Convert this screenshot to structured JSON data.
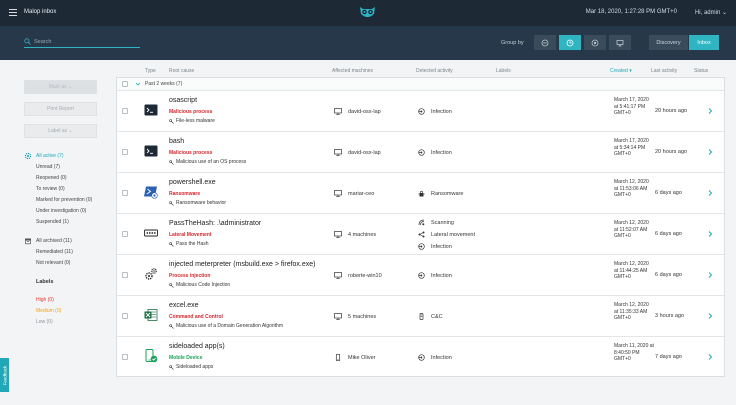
{
  "header": {
    "app_title": "Malop inbox",
    "datetime": "Mar 18, 2020, 1:27:28 PM GMT+0",
    "user_greeting": "Hi, admin"
  },
  "toolbar": {
    "search_placeholder": "Search",
    "group_by_label": "Group by",
    "discovery_label": "Discovery",
    "inbox_label": "Inbox"
  },
  "sidebar": {
    "mark_as_label": "Mark as",
    "print_report_label": "Print Report",
    "label_as_label": "Label as",
    "all_active": "All active  (7)",
    "active_items": [
      "Unread (7)",
      "Reopened (0)",
      "To review (0)",
      "Marked for prevention (0)",
      "Under investigation (0)",
      "Suspended (1)"
    ],
    "all_archived": "All archived   (11)",
    "archived_items": [
      "Remediated (11)",
      "Not relevant (0)"
    ],
    "labels_title": "Labels",
    "label_high": "High (0)",
    "label_medium": "Medium (0)",
    "label_low": "Low (0)",
    "feedback": "Feedback"
  },
  "table": {
    "columns": {
      "type": "Type",
      "root_cause": "Root cause",
      "affected": "Affected machines",
      "detected": "Detected activity",
      "labels": "Labels",
      "created": "Created",
      "last_activity": "Last activity",
      "status": "Status"
    },
    "group_label": "Past 2 weeks (7)",
    "rows": [
      {
        "icon": "terminal-icon",
        "name": "osascript",
        "cause": "Malicious process",
        "cause_color": "red",
        "sub": "File-less malware",
        "machine_icon": "monitor-icon",
        "machine": "david-osx-lap",
        "activities": [
          {
            "icon": "infection-icon",
            "label": "Infection"
          }
        ],
        "created": "March 17, 2020 at 5:41:17 PM GMT+0",
        "last": "20 hours ago"
      },
      {
        "icon": "terminal-icon",
        "name": "bash",
        "cause": "Malicious process",
        "cause_color": "red",
        "sub": "Malicious use of an OS process",
        "machine_icon": "monitor-icon",
        "machine": "david-osx-lap",
        "activities": [
          {
            "icon": "infection-icon",
            "label": "Infection"
          }
        ],
        "created": "March 17, 2020 at 5:34:14 PM GMT+0",
        "last": "20 hours ago"
      },
      {
        "icon": "powershell-icon",
        "name": "powershell.exe",
        "cause": "Ransomware",
        "cause_color": "red",
        "sub": "Ransomware behavior",
        "machine_icon": "monitor-icon",
        "machine": "mariar-ceo",
        "activities": [
          {
            "icon": "ransomware-icon",
            "label": "Ransomware"
          }
        ],
        "created": "March 12, 2020 at 11:53:06 AM GMT+0",
        "last": "6 days ago"
      },
      {
        "icon": "password-icon",
        "name": "PassTheHash: .\\administrator",
        "cause": "Lateral Movement",
        "cause_color": "red",
        "sub": "Pass the Hash",
        "machine_icon": "monitor-icon",
        "machine": "4 machines",
        "activities": [
          {
            "icon": "scanning-icon",
            "label": "Scanning"
          },
          {
            "icon": "lateral-movement-icon",
            "label": "Lateral movement"
          },
          {
            "icon": "infection-icon",
            "label": "Infection"
          }
        ],
        "created": "March 12, 2020 at 11:52:07 AM GMT+0",
        "last": "6 days ago"
      },
      {
        "icon": "gears-icon",
        "name": "injected meterpreter (msbuild.exe > firefox.exe)",
        "cause": "Process injection",
        "cause_color": "red",
        "sub": "Malicious Code Injection",
        "machine_icon": "monitor-icon",
        "machine": "roberte-win10",
        "activities": [
          {
            "icon": "infection-icon",
            "label": "Infection"
          }
        ],
        "created": "March 12, 2020 at 11:44:25 AM GMT+0",
        "last": "6 days ago"
      },
      {
        "icon": "excel-icon",
        "name": "excel.exe",
        "cause": "Command and Control",
        "cause_color": "red",
        "sub": "Malicious use of a Domain Generation Algorithm",
        "machine_icon": "monitor-icon",
        "machine": "5 machines",
        "activities": [
          {
            "icon": "cnc-icon",
            "label": "C&C"
          }
        ],
        "created": "March 12, 2020 at 11:35:33 AM GMT+0",
        "last": "3 hours ago"
      },
      {
        "icon": "mobile-app-icon",
        "name": "sideloaded app(s)",
        "cause": "Mobile Device",
        "cause_color": "green",
        "sub": "Sideloaded apps",
        "machine_icon": "phone-icon",
        "machine": "Mike Oliver",
        "activities": [
          {
            "icon": "infection-icon",
            "label": "Infection"
          }
        ],
        "created": "March 11, 2020 at 8:40:50 PM GMT+0",
        "last": "7 days ago"
      }
    ]
  }
}
